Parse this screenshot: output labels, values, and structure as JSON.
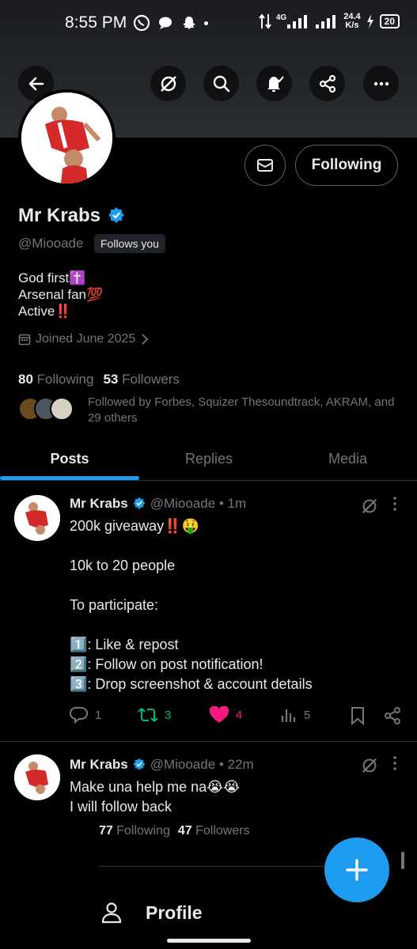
{
  "status_bar": {
    "time": "8:55 PM",
    "network": "4G",
    "speed_value": "24.4",
    "speed_unit": "K/s",
    "battery": "20"
  },
  "toolbar": {
    "back": "back-arrow-icon",
    "grok": "grok-icon",
    "search": "search-icon",
    "notifications": "bell-icon",
    "share": "share-icon",
    "more": "more-icon"
  },
  "profile": {
    "name": "Mr Krabs",
    "handle": "@Miooade",
    "follows_you": "Follows you",
    "bio_lines": [
      "God first✝️",
      "Arsenal fan💯",
      "Active‼️"
    ],
    "joined": "Joined June 2025",
    "following_count": "80",
    "following_label": "Following",
    "followers_count": "53",
    "followers_label": "Followers",
    "followed_by": "Followed by Forbes, Squizer Thesoundtrack, AKRAM, and 29 others",
    "follow_button": "Following"
  },
  "tabs": [
    {
      "label": "Posts",
      "active": true
    },
    {
      "label": "Replies",
      "active": false
    },
    {
      "label": "Media",
      "active": false
    }
  ],
  "posts": [
    {
      "name": "Mr Krabs",
      "meta": "@Miooade • 1m",
      "text": "200k giveaway‼️🤑\n\n10k to 20 people\n\nTo participate:\n\n1️⃣: Like & repost\n2️⃣: Follow on  post notification!\n3️⃣: Drop screenshot & account details",
      "replies": "1",
      "reposts": "3",
      "likes": "4",
      "views": "5"
    },
    {
      "name": "Mr Krabs",
      "meta": "@Miooade • 22m",
      "text": "Make una help me na😭😭\nI will follow back"
    }
  ],
  "hover_card": {
    "following_count": "77",
    "following_label": "Following",
    "followers_count": "47",
    "followers_label": "Followers",
    "profile_label": "Profile"
  },
  "colors": {
    "accent": "#1d9bf0",
    "repost_active": "#00ba7c",
    "like_active": "#f91880"
  }
}
